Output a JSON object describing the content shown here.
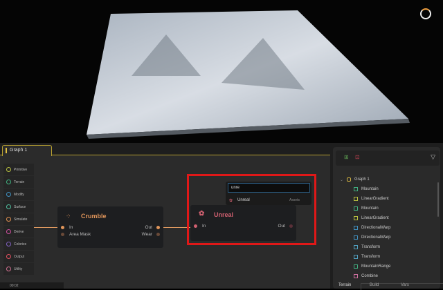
{
  "tab": {
    "label": "Graph 1"
  },
  "palette": [
    "Primitive",
    "Terrain",
    "Modify",
    "Surface",
    "Simulate",
    "Derive",
    "Colorize",
    "Output",
    "Utility"
  ],
  "palette_colors": [
    "#b8c040",
    "#40b080",
    "#4090c0",
    "#50c0a0",
    "#e09050",
    "#d050a0",
    "#8060c0",
    "#e05060",
    "#d07090"
  ],
  "crumble": {
    "title": "Crumble",
    "inputs": [
      "In",
      "Area Mask"
    ],
    "outputs": [
      "Out",
      "Wear"
    ],
    "color": "#e0955a"
  },
  "unreal": {
    "title": "Unreal",
    "input": "In",
    "output": "Out",
    "color": "#d06070"
  },
  "search": {
    "value": "unre",
    "result": "Unreal",
    "category": "Assets"
  },
  "tree": {
    "root": "Graph 1",
    "items": [
      "Mountain",
      "LinearGradient",
      "Mountain",
      "LinearGradient",
      "DirectionalWarp",
      "DirectionalWarp",
      "Transform",
      "Transform",
      "MountainRange",
      "Combine"
    ]
  },
  "bottom_tabs": [
    "Terrain",
    "Build",
    "Vars"
  ],
  "status": {
    "time": "00:02"
  }
}
